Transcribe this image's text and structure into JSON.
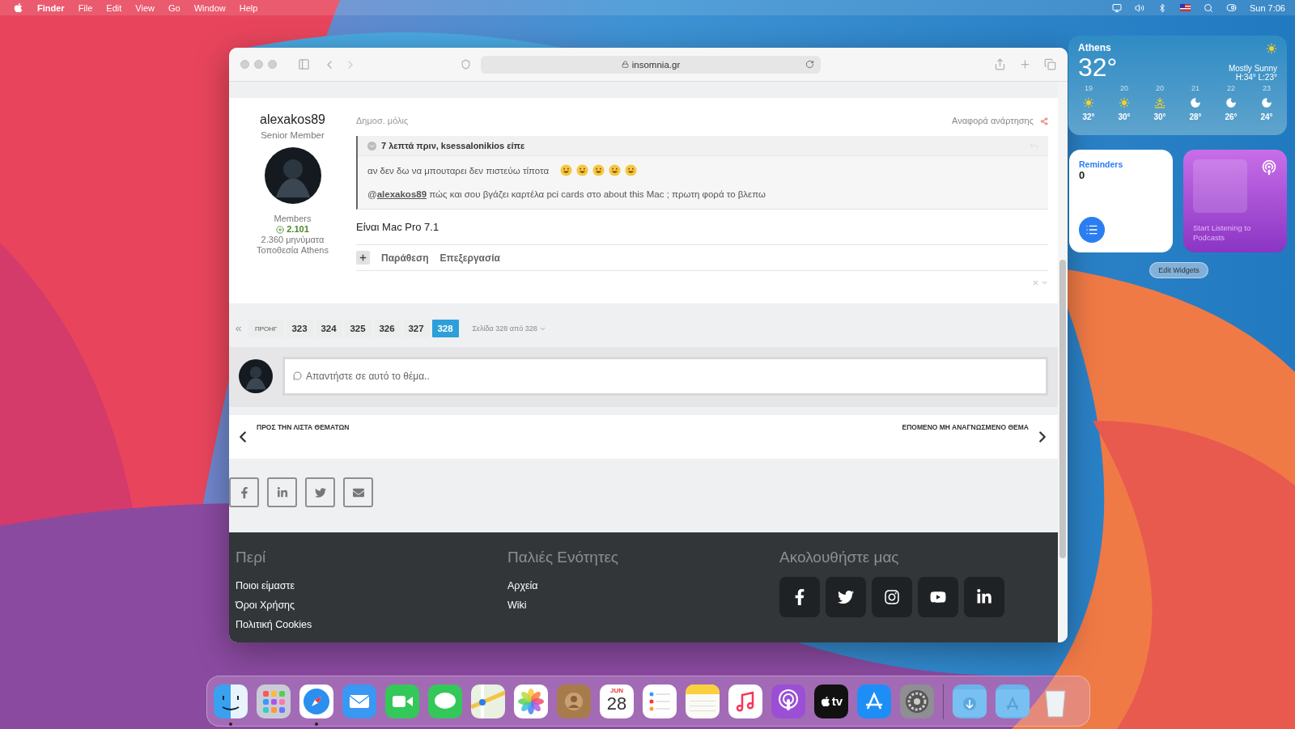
{
  "menubar": {
    "app": "Finder",
    "menus": [
      "File",
      "Edit",
      "View",
      "Go",
      "Window",
      "Help"
    ],
    "clock": "Sun 7:06"
  },
  "browser": {
    "url": "insomnia.gr",
    "post": {
      "author": "alexakos89",
      "rank": "Senior Member",
      "group": "Members",
      "reputation": "2.101",
      "posts": "2.360 μηνύματα",
      "location": "Τοποθεσία Athens",
      "meta": "Δημοσ. μόλις",
      "report": "Αναφορά ανάρτησης",
      "quote": {
        "header": "7 λεπτά πριν, ksessalonikios είπε",
        "line": "αν δεν δω να μπουταρει δεν πιστεύω τίποτα",
        "mention_prefix": "@",
        "mention": "alexakos89",
        "reply": "πώς και σου βγάζει καρτέλα pci cards στο about this Mac ; πρωτη φορά το βλεπω"
      },
      "body": "Είναι Mac Pro 7.1",
      "actions": [
        "Παράθεση",
        "Επεξεργασία"
      ]
    },
    "pagination": {
      "prev": "ΠΡΟΗΓ",
      "pages": [
        {
          "label": "323",
          "selected": false
        },
        {
          "label": "324",
          "selected": false
        },
        {
          "label": "325",
          "selected": false
        },
        {
          "label": "326",
          "selected": false
        },
        {
          "label": "327",
          "selected": false
        },
        {
          "label": "328",
          "selected": true
        }
      ],
      "page_info": "Σελίδα 328 από 328"
    },
    "reply": {
      "placeholder": "Απαντήστε σε αυτό το θέμα.."
    },
    "nav": {
      "prev": "ΠΡΟΣ ΤΗΝ ΛΙΣΤΑ ΘΕΜΑΤΩΝ",
      "next": "ΕΠΟΜΕΝΟ ΜΗ ΑΝΑΓΝΩΣΜΕΝΟ ΘΕΜΑ"
    },
    "share": [
      {
        "kind": "facebook"
      },
      {
        "kind": "linkedin"
      },
      {
        "kind": "twitter"
      },
      {
        "kind": "email"
      }
    ],
    "footer": {
      "columns": [
        {
          "title": "Περί",
          "links": [
            "Ποιοι είμαστε",
            "Όροι Χρήσης",
            "Πολιτική Cookies"
          ]
        },
        {
          "title": "Παλιές Ενότητες",
          "links": [
            "Αρχεία",
            "Wiki"
          ]
        }
      ],
      "follow": {
        "title": "Ακολουθήστε μας",
        "networks": [
          {
            "kind": "facebook"
          },
          {
            "kind": "twitter"
          },
          {
            "kind": "instagram"
          },
          {
            "kind": "youtube"
          },
          {
            "kind": "linkedin"
          }
        ]
      }
    }
  },
  "weather": {
    "city": "Athens",
    "temp": "32°",
    "condition": "Mostly Sunny",
    "hilo": "H:34° L:23°",
    "hours": [
      {
        "time": "19",
        "temp": "32°",
        "kind": "sun"
      },
      {
        "time": "20",
        "temp": "30°",
        "kind": "sun"
      },
      {
        "time": "20",
        "temp": "30°",
        "kind": "sunset"
      },
      {
        "time": "21",
        "temp": "28°",
        "kind": "moon"
      },
      {
        "time": "22",
        "temp": "26°",
        "kind": "moon"
      },
      {
        "time": "23",
        "temp": "24°",
        "kind": "moon"
      }
    ]
  },
  "reminders": {
    "title": "Reminders",
    "count": "0"
  },
  "podcasts": {
    "text": "Start Listening to Podcasts"
  },
  "edit_widgets": "Edit Widgets",
  "dock": [
    {
      "kind": "finder",
      "running": true
    },
    {
      "kind": "launchpad",
      "running": false
    },
    {
      "kind": "safari",
      "running": true
    },
    {
      "kind": "mail",
      "running": false
    },
    {
      "kind": "facetime",
      "running": false
    },
    {
      "kind": "messages",
      "running": false
    },
    {
      "kind": "maps",
      "running": false
    },
    {
      "kind": "photos",
      "running": false
    },
    {
      "kind": "contacts",
      "running": false
    },
    {
      "kind": "calendar",
      "running": false,
      "month": "JUN",
      "day": "28"
    },
    {
      "kind": "reminders",
      "running": false
    },
    {
      "kind": "notes",
      "running": false
    },
    {
      "kind": "music",
      "running": false
    },
    {
      "kind": "podcasts",
      "running": false
    },
    {
      "kind": "tv",
      "running": false,
      "label": "tv"
    },
    {
      "kind": "appstore",
      "running": false
    },
    {
      "kind": "settings",
      "running": false
    },
    {
      "kind": "separator"
    },
    {
      "kind": "downloads",
      "running": false
    },
    {
      "kind": "applications",
      "running": false
    },
    {
      "kind": "trash",
      "running": false
    }
  ]
}
